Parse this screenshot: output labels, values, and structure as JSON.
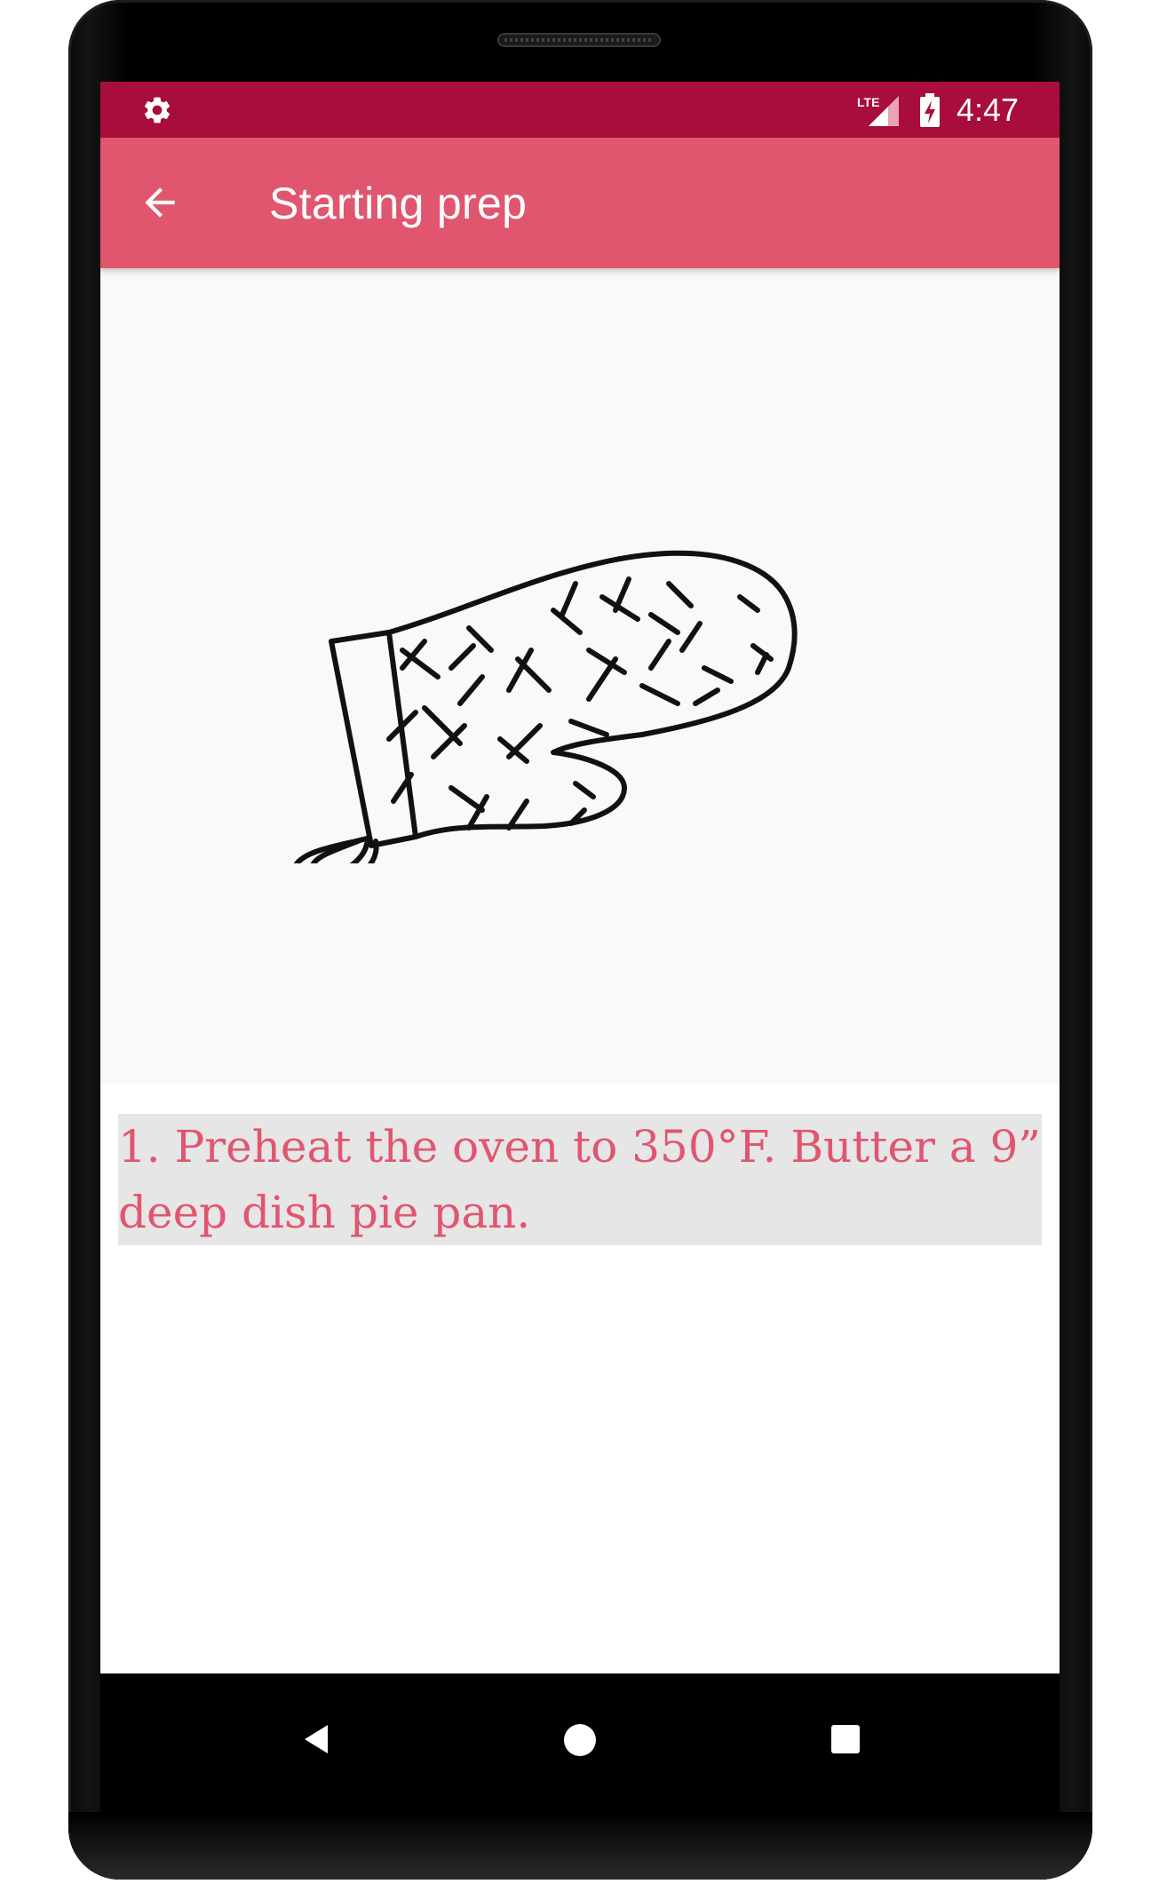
{
  "status_bar": {
    "time": "4:47",
    "network": "LTE",
    "settings_icon": "gear-icon",
    "signal_icon": "lte-signal-icon",
    "battery_icon": "battery-charging-icon",
    "color": "#a80d3b"
  },
  "toolbar": {
    "title": "Starting prep",
    "back_icon": "arrow-back-icon",
    "color": "#e0566f"
  },
  "illustration": {
    "icon": "oven-mitt-illustration"
  },
  "step": {
    "text": "1. Preheat the oven to 350°F. Butter a 9” deep dish pie pan.",
    "text_color": "#e0566f",
    "background": "#e6e6e6"
  },
  "nav_bar": {
    "back_icon": "triangle-back-icon",
    "home_icon": "circle-home-icon",
    "recents_icon": "square-recents-icon"
  }
}
